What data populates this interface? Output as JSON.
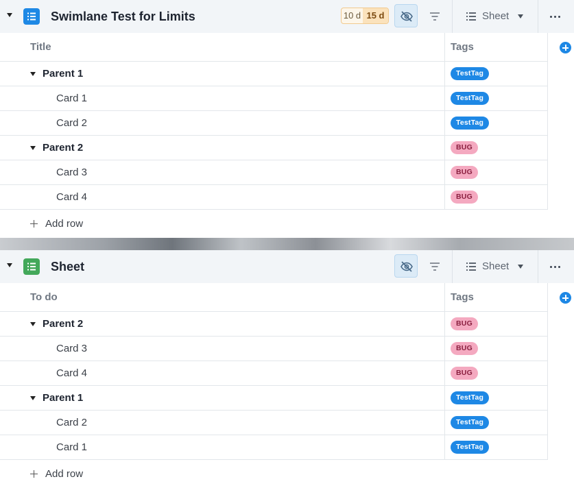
{
  "panels": [
    {
      "title": "Swimlane Test for Limits",
      "icon": "list-icon",
      "icon_color": "#1e88e5",
      "time_badge": {
        "estimate": "10 d",
        "limit": "15 d"
      },
      "view": {
        "label": "Sheet"
      },
      "columns": {
        "title": "Title",
        "tags": "Tags"
      },
      "rows": [
        {
          "label": "Parent 1",
          "parent": true,
          "tag": "TestTag"
        },
        {
          "label": "Card 1",
          "parent": false,
          "tag": "TestTag"
        },
        {
          "label": "Card 2",
          "parent": false,
          "tag": "TestTag"
        },
        {
          "label": "Parent 2",
          "parent": true,
          "tag": "BUG"
        },
        {
          "label": "Card 3",
          "parent": false,
          "tag": "BUG"
        },
        {
          "label": "Card 4",
          "parent": false,
          "tag": "BUG"
        }
      ],
      "add_row": "Add row"
    },
    {
      "title": "Sheet",
      "icon": "list-icon",
      "icon_color": "#43a85a",
      "view": {
        "label": "Sheet"
      },
      "columns": {
        "title": "To do",
        "tags": "Tags"
      },
      "rows": [
        {
          "label": "Parent 2",
          "parent": true,
          "tag": "BUG"
        },
        {
          "label": "Card 3",
          "parent": false,
          "tag": "BUG"
        },
        {
          "label": "Card 4",
          "parent": false,
          "tag": "BUG"
        },
        {
          "label": "Parent 1",
          "parent": true,
          "tag": "TestTag"
        },
        {
          "label": "Card 2",
          "parent": false,
          "tag": "TestTag"
        },
        {
          "label": "Card 1",
          "parent": false,
          "tag": "TestTag"
        }
      ],
      "add_row": "Add row"
    }
  ],
  "tag_styles": {
    "TestTag": {
      "bg": "#1e88e5",
      "fg": "#ffffff"
    },
    "BUG": {
      "bg": "#f4a9c0",
      "fg": "#8a1f3f"
    }
  }
}
